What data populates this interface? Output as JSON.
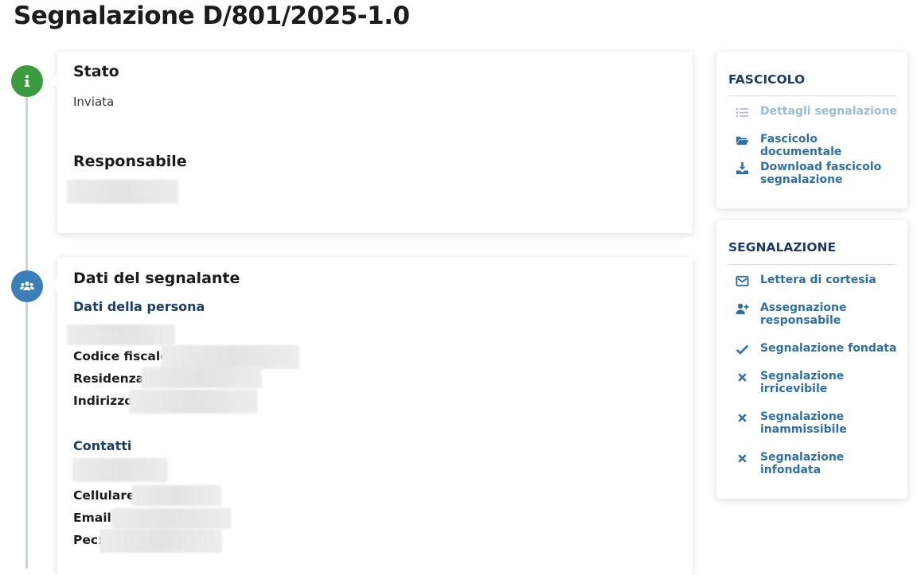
{
  "page": {
    "title": "Segnalazione D/801/2025-1.0"
  },
  "cards": {
    "stato": {
      "heading": "Stato",
      "value": "Inviata",
      "responsabile_heading": "Responsabile"
    },
    "segnalante": {
      "heading": "Dati del segnalante",
      "persona_heading": "Dati della persona",
      "codice_fiscale_label": "Codice fiscale:",
      "residenza_label": "Residenza:",
      "indirizzo_label": "Indirizzo:",
      "contatti_heading": "Contatti",
      "cellulare_label": "Cellulare:",
      "email_label": "Email:",
      "pec_label": "Pec:"
    }
  },
  "sidebar": {
    "fascicolo": {
      "title": "FASCICOLO",
      "items": [
        {
          "label": "Dettagli segnalazione",
          "icon": "list-icon",
          "disabled": true
        },
        {
          "label": "Fascicolo documentale",
          "icon": "folder-open-icon"
        },
        {
          "label": "Download fascicolo segnalazione",
          "icon": "download-icon"
        }
      ]
    },
    "segnalazione": {
      "title": "SEGNALAZIONE",
      "items": [
        {
          "label": "Lettera di cortesia",
          "icon": "envelope-icon"
        },
        {
          "label": "Assegnazione responsabile",
          "icon": "user-plus-icon"
        },
        {
          "label": "Segnalazione fondata",
          "icon": "check-icon"
        },
        {
          "label": "Segnalazione irricevibile",
          "icon": "x-icon"
        },
        {
          "label": "Segnalazione inammissibile",
          "icon": "x-icon"
        },
        {
          "label": "Segnalazione infondata",
          "icon": "x-icon"
        }
      ]
    }
  },
  "colors": {
    "accent": "#2d6fa6",
    "heading_blue": "#1d3d66",
    "status_green": "#3b9b3f",
    "timeline_blue": "#3a7fb8",
    "disabled": "#96bdd9"
  }
}
